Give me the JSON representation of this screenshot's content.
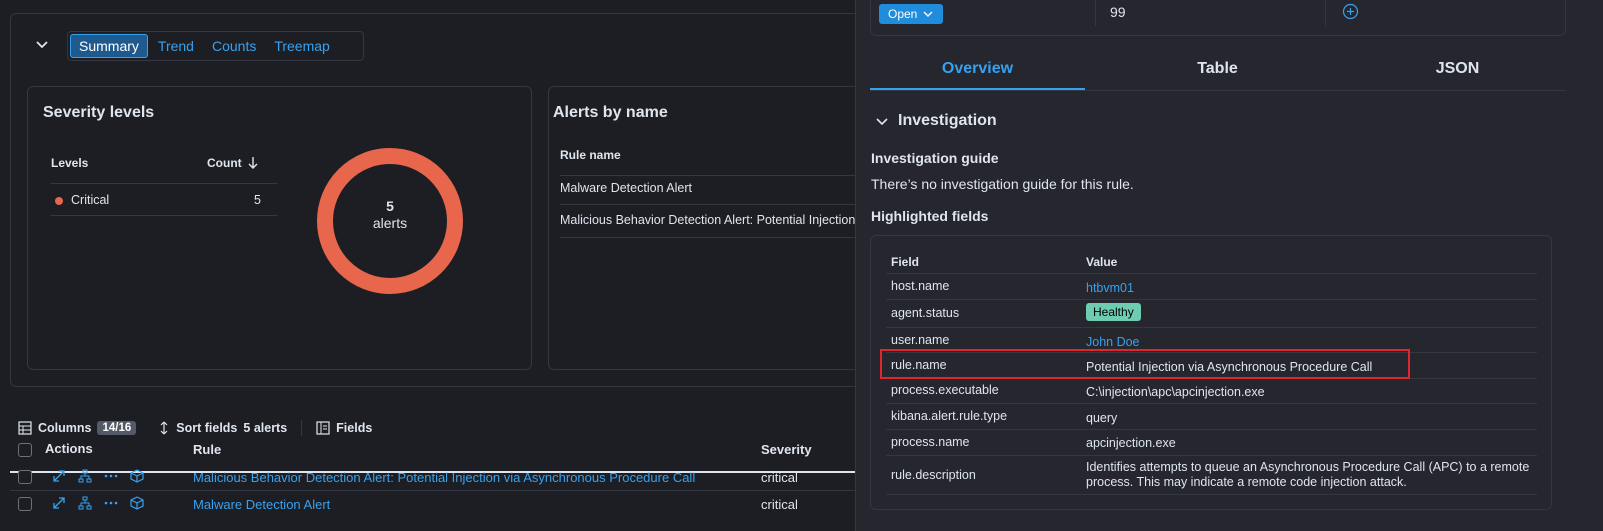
{
  "summary": {
    "tabs": [
      "Summary",
      "Trend",
      "Counts",
      "Treemap"
    ],
    "active_tab": "Summary"
  },
  "severity_card": {
    "title": "Severity levels",
    "col_levels": "Levels",
    "col_count": "Count",
    "rows": [
      {
        "level": "Critical",
        "count": "5"
      }
    ],
    "donut_count": "5",
    "donut_label": "alerts",
    "donut_color": "#e7664c"
  },
  "alerts_card": {
    "title": "Alerts by name",
    "col_rule": "Rule name",
    "rows": [
      "Malware Detection Alert",
      "Malicious Behavior Detection Alert: Potential Injection"
    ]
  },
  "toolbar": {
    "columns_label": "Columns",
    "columns_count": "14/16",
    "sort_label": "Sort fields",
    "alerts_count": "5 alerts",
    "fields_label": "Fields"
  },
  "grid": {
    "col_actions": "Actions",
    "col_rule": "Rule",
    "col_severity": "Severity",
    "rows": [
      {
        "rule": "Malicious Behavior Detection Alert: Potential Injection via Asynchronous Procedure Call",
        "severity": "critical"
      },
      {
        "rule": "Malware Detection Alert",
        "severity": "critical"
      }
    ]
  },
  "flyout": {
    "status_button": "Open",
    "risk_score": "99",
    "tabs": [
      "Overview",
      "Table",
      "JSON"
    ],
    "active_tab": "Overview",
    "section_title": "Investigation",
    "guide_title": "Investigation guide",
    "guide_text": "There’s no investigation guide for this rule.",
    "highlighted_title": "Highlighted fields",
    "col_field": "Field",
    "col_value": "Value",
    "fields": [
      {
        "field": "host.name",
        "value": "htbvm01"
      },
      {
        "field": "agent.status",
        "value": "Healthy"
      },
      {
        "field": "user.name",
        "value": "John Doe"
      },
      {
        "field": "rule.name",
        "value": "Potential Injection via Asynchronous Procedure Call"
      },
      {
        "field": "process.executable",
        "value": "C:\\injection\\apc\\apcinjection.exe"
      },
      {
        "field": "kibana.alert.rule.type",
        "value": "query"
      },
      {
        "field": "process.name",
        "value": "apcinjection.exe"
      },
      {
        "field": "rule.description",
        "value": "Identifies attempts to queue an Asynchronous Procedure Call (APC) to a remote process. This may indicate a remote code injection attack."
      }
    ]
  }
}
